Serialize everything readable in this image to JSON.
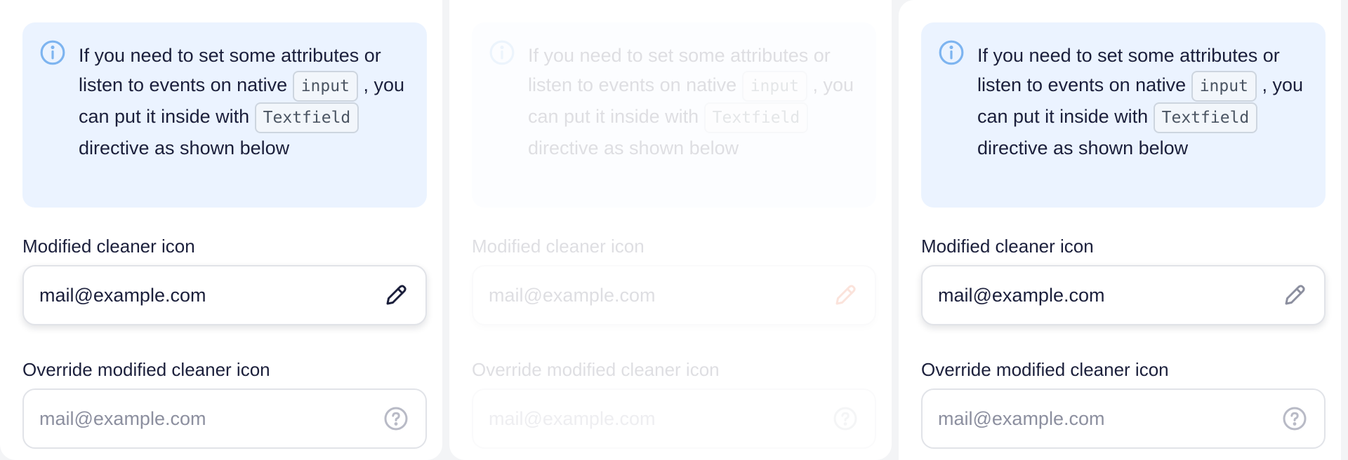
{
  "panels": [
    {
      "notice": {
        "before_input": "If you need to set some attributes or listen to events on native",
        "code_input": "input",
        "after_input": ", you can put it inside with",
        "code_textfield": "Textfield",
        "after_textfield": "directive as shown below"
      },
      "field1": {
        "label": "Modified cleaner icon",
        "value": "mail@example.com",
        "icon": "pencil-icon",
        "icon_color": "#1b1f3b"
      },
      "field2": {
        "label": "Override modified cleaner icon",
        "placeholder": "mail@example.com",
        "icon": "question-circle-icon",
        "icon_color": "#b8bac6"
      }
    },
    {
      "notice": {
        "before_input": "If you need to set some attributes or listen to events on native",
        "code_input": "input",
        "after_input": ", you can put it inside with",
        "code_textfield": "Textfield",
        "after_textfield": "directive as shown below"
      },
      "field1": {
        "label": "Modified cleaner icon",
        "value": "mail@example.com",
        "icon": "pencil-icon",
        "icon_color": "#e8410a"
      },
      "field2": {
        "label": "Override modified cleaner icon",
        "placeholder": "mail@example.com",
        "icon": "question-circle-icon",
        "icon_color": "#b8bac6"
      }
    },
    {
      "notice": {
        "before_input": "If you need to set some attributes or listen to events on native",
        "code_input": "input",
        "after_input": ", you can put it inside with",
        "code_textfield": "Textfield",
        "after_textfield": "directive as shown below"
      },
      "field1": {
        "label": "Modified cleaner icon",
        "value": "mail@example.com",
        "icon": "pencil-icon",
        "icon_color": "#8c8f9f"
      },
      "field2": {
        "label": "Override modified cleaner icon",
        "placeholder": "mail@example.com",
        "icon": "question-circle-icon",
        "icon_color": "#b8bac6"
      }
    }
  ],
  "colors": {
    "notice_bg": "#ebf3ff",
    "info_icon": "#7db4f0",
    "text": "#1b1f3b"
  }
}
